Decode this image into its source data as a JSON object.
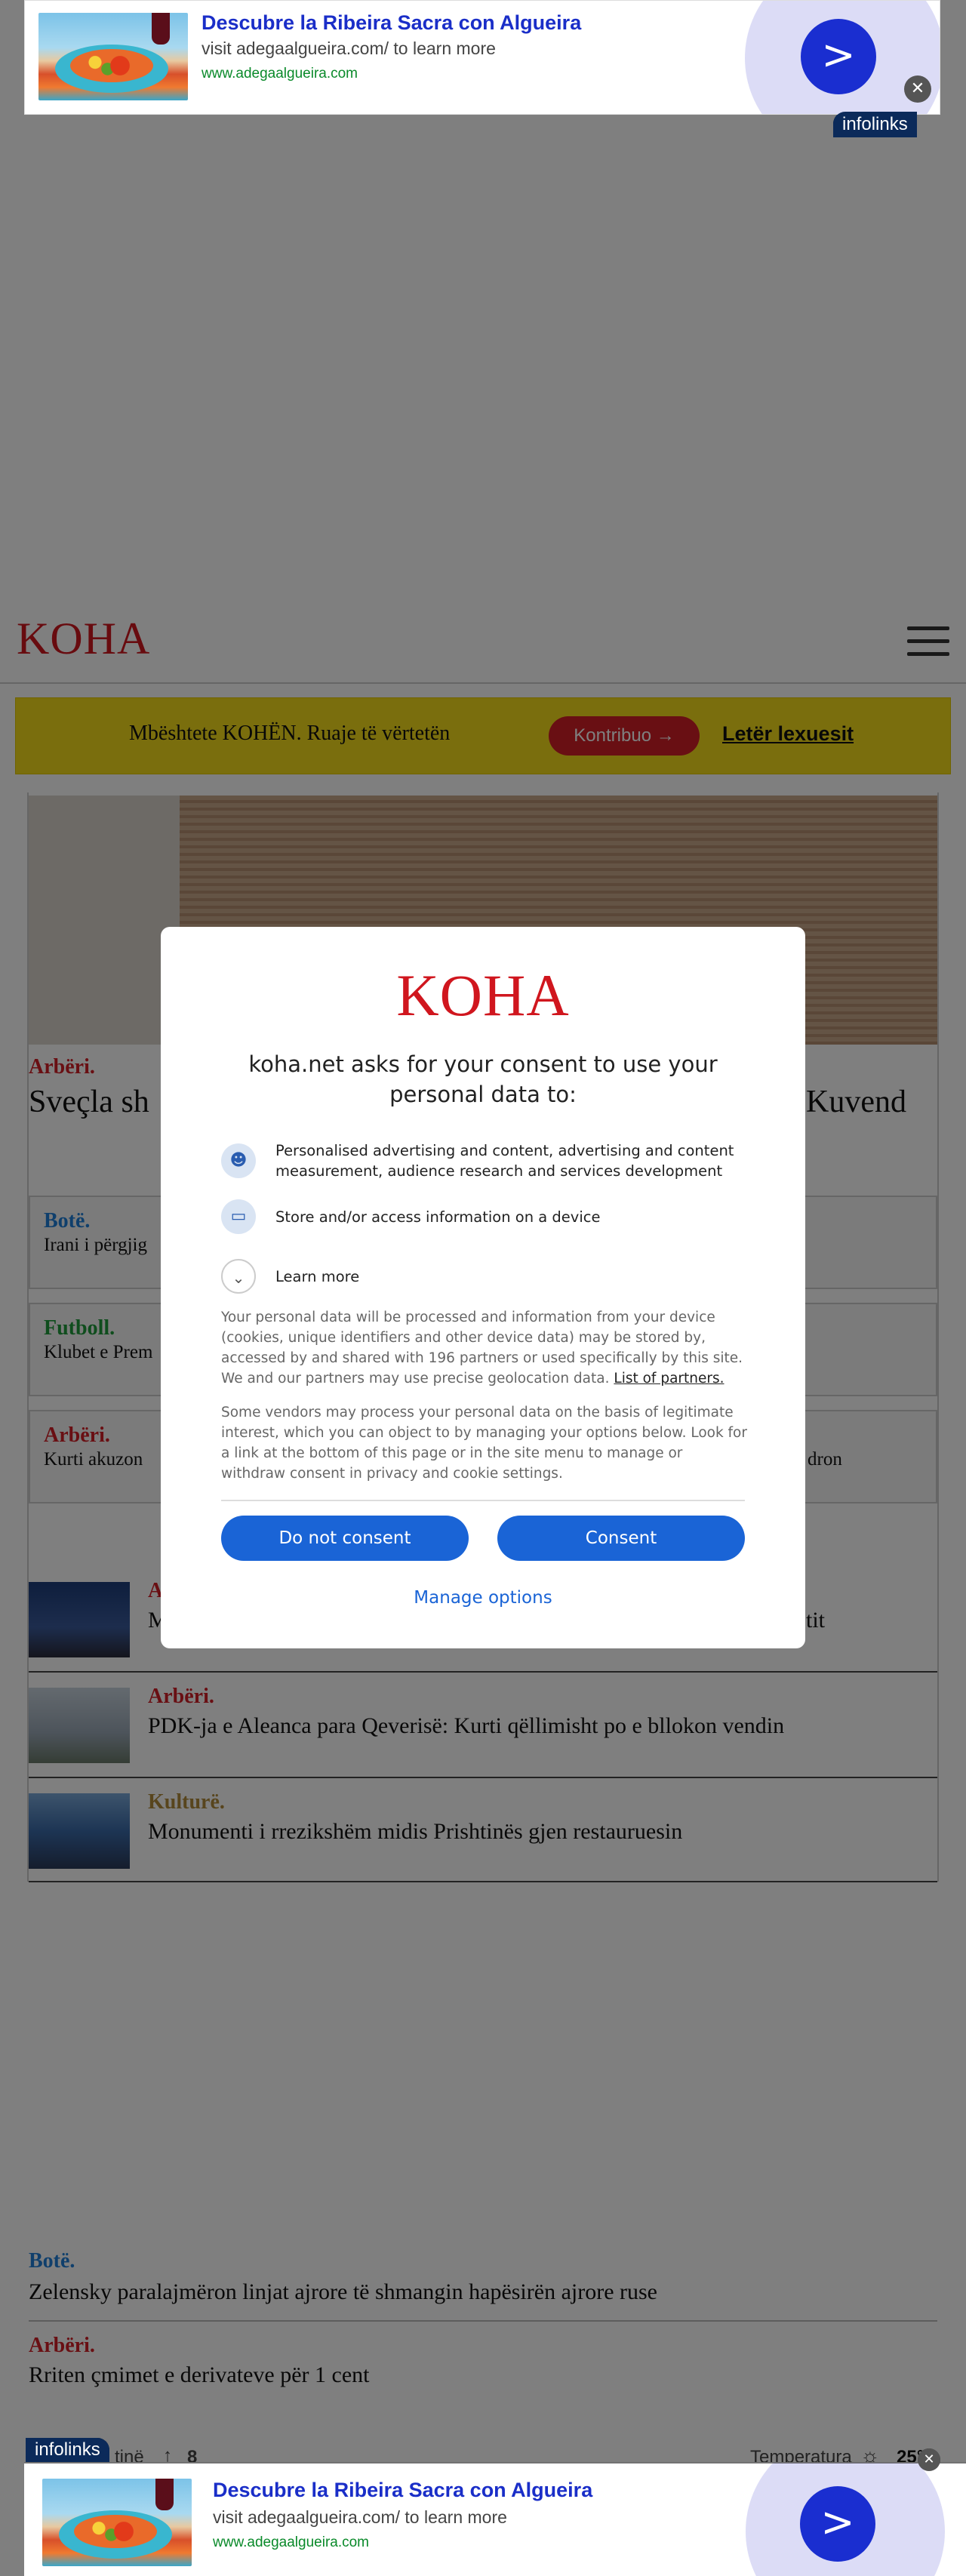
{
  "top_ad": {
    "title": "Descubre la Ribeira Sacra con Algueira",
    "subtitle": "visit adegaalgueira.com/ to learn more",
    "url": "www.adegaalgueira.com",
    "arrow": ">",
    "close": "✕",
    "brand": "infolinks"
  },
  "header": {
    "logo": "KOHA",
    "menu_icon": "hamburger-icon"
  },
  "support_banner": {
    "text": "Mbështete KOHËN. Ruaje të vërtetën",
    "button": "Kontribuo →",
    "link": "Letër lexuesit"
  },
  "lead": {
    "category": "Arbëri.",
    "title_left": "Sveçla sh",
    "title_right": "Kuvend"
  },
  "cards": [
    {
      "category": "Botë.",
      "title": "Irani i përgjig"
    },
    {
      "category": "Futboll.",
      "title": "Klubet e Prem"
    },
    {
      "category": "Arbëri.",
      "title": "Kurti akuzon",
      "title_right": "dron"
    }
  ],
  "rows": [
    {
      "category": "A",
      "title": "M",
      "title_right": "tit"
    },
    {
      "category": "Arbëri.",
      "title": "PDK-ja e Aleanca para Qeverisë: Kurti qëllimisht po e bllokon vendin"
    },
    {
      "category": "Kulturë.",
      "title": "Monumenti i rrezikshëm midis Prishtinës gjen restauruesin"
    }
  ],
  "bottom_list": [
    {
      "category": "Botë.",
      "title": "Zelensky paralajmëron linjat ajrore të shmangin hapësirën ajrore ruse"
    },
    {
      "category": "Arbëri.",
      "title": "Rriten çmimet e derivateve për 1 cent"
    }
  ],
  "footer_bar": {
    "left_label": "tinë",
    "arrow": "↑",
    "count": "8",
    "temp_label": "Temperatura",
    "temp_value": "25°"
  },
  "consent": {
    "logo": "KOHA",
    "heading": "koha.net asks for your consent to use your personal data to:",
    "item1": "Personalised advertising and content, advertising and content measurement, audience research and services development",
    "item2": "Store and/or access information on a device",
    "learn_more": "Learn more",
    "para1": "Your personal data will be processed and information from your device (cookies, unique identifiers and other device data) may be stored by, accessed by and shared with 196 partners or used specifically by this site. We and our partners may use precise geolocation data.",
    "partners_link": "List of partners.",
    "para2": "Some vendors may process your personal data on the basis of legitimate interest, which you can object to by managing your options below. Look for a link at the bottom of this page or in the site menu to manage or withdraw consent in privacy and cookie settings.",
    "btn_decline": "Do not consent",
    "btn_accept": "Consent",
    "manage": "Manage options"
  },
  "bottom_ad": {
    "title": "Descubre la Ribeira Sacra con Algueira",
    "subtitle": "visit adegaalgueira.com/ to learn more",
    "url": "www.adegaalgueira.com",
    "arrow": ">",
    "close": "✕",
    "brand": "infolinks"
  }
}
